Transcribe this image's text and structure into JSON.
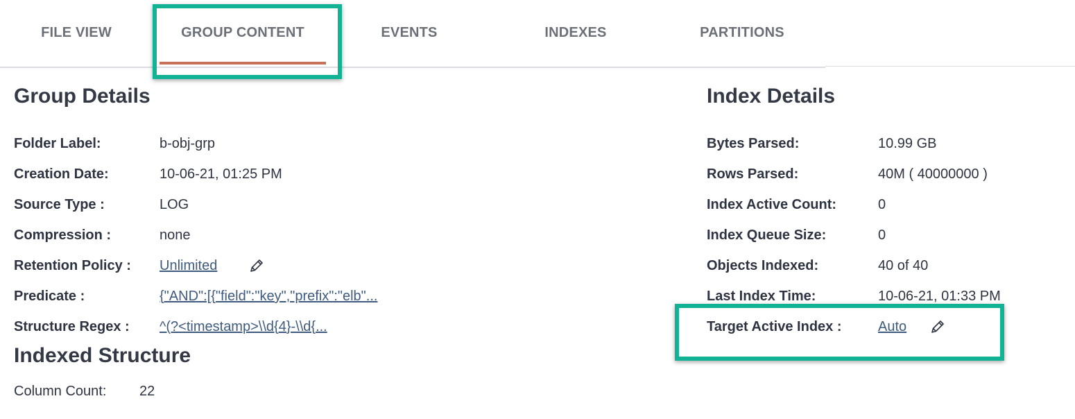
{
  "tabs": [
    {
      "label": "FILE VIEW"
    },
    {
      "label": "GROUP CONTENT",
      "active": true
    },
    {
      "label": "EVENTS"
    },
    {
      "label": "INDEXES"
    },
    {
      "label": "PARTITIONS"
    }
  ],
  "group_details": {
    "title": "Group Details",
    "folder_label": {
      "label": "Folder Label:",
      "value": "b-obj-grp"
    },
    "creation_date": {
      "label": "Creation Date:",
      "value": "10-06-21, 01:25 PM"
    },
    "source_type": {
      "label": "Source Type :",
      "value": "LOG"
    },
    "compression": {
      "label": "Compression :",
      "value": "none"
    },
    "retention_policy": {
      "label": "Retention Policy :",
      "value": "Unlimited"
    },
    "predicate": {
      "label": "Predicate :",
      "value": "{\"AND\":[{\"field\":\"key\",\"prefix\":\"elb\"..."
    },
    "structure_regex": {
      "label": "Structure Regex :",
      "value": "^(?<timestamp>\\\\d{4}-\\\\d{..."
    }
  },
  "indexed_structure": {
    "title": "Indexed Structure",
    "column_count": {
      "label": "Column Count:",
      "value": "22"
    }
  },
  "index_details": {
    "title": "Index Details",
    "bytes_parsed": {
      "label": "Bytes Parsed:",
      "value": "10.99 GB"
    },
    "rows_parsed": {
      "label": "Rows Parsed:",
      "value": "40M ( 40000000 )"
    },
    "index_active_count": {
      "label": "Index Active Count:",
      "value": "0"
    },
    "index_queue_size": {
      "label": "Index Queue Size:",
      "value": "0"
    },
    "objects_indexed": {
      "label": "Objects Indexed:",
      "value": "40 of 40"
    },
    "last_index_time": {
      "label": "Last Index Time:",
      "value": "10-06-21, 01:33 PM"
    },
    "target_active_index": {
      "label": "Target Active Index :",
      "value": "Auto"
    }
  },
  "icons": {
    "edit": "pencil-icon"
  },
  "colors": {
    "highlight": "#12b394",
    "active_tab_underline": "#c8705a",
    "link": "#3f5a7f"
  }
}
